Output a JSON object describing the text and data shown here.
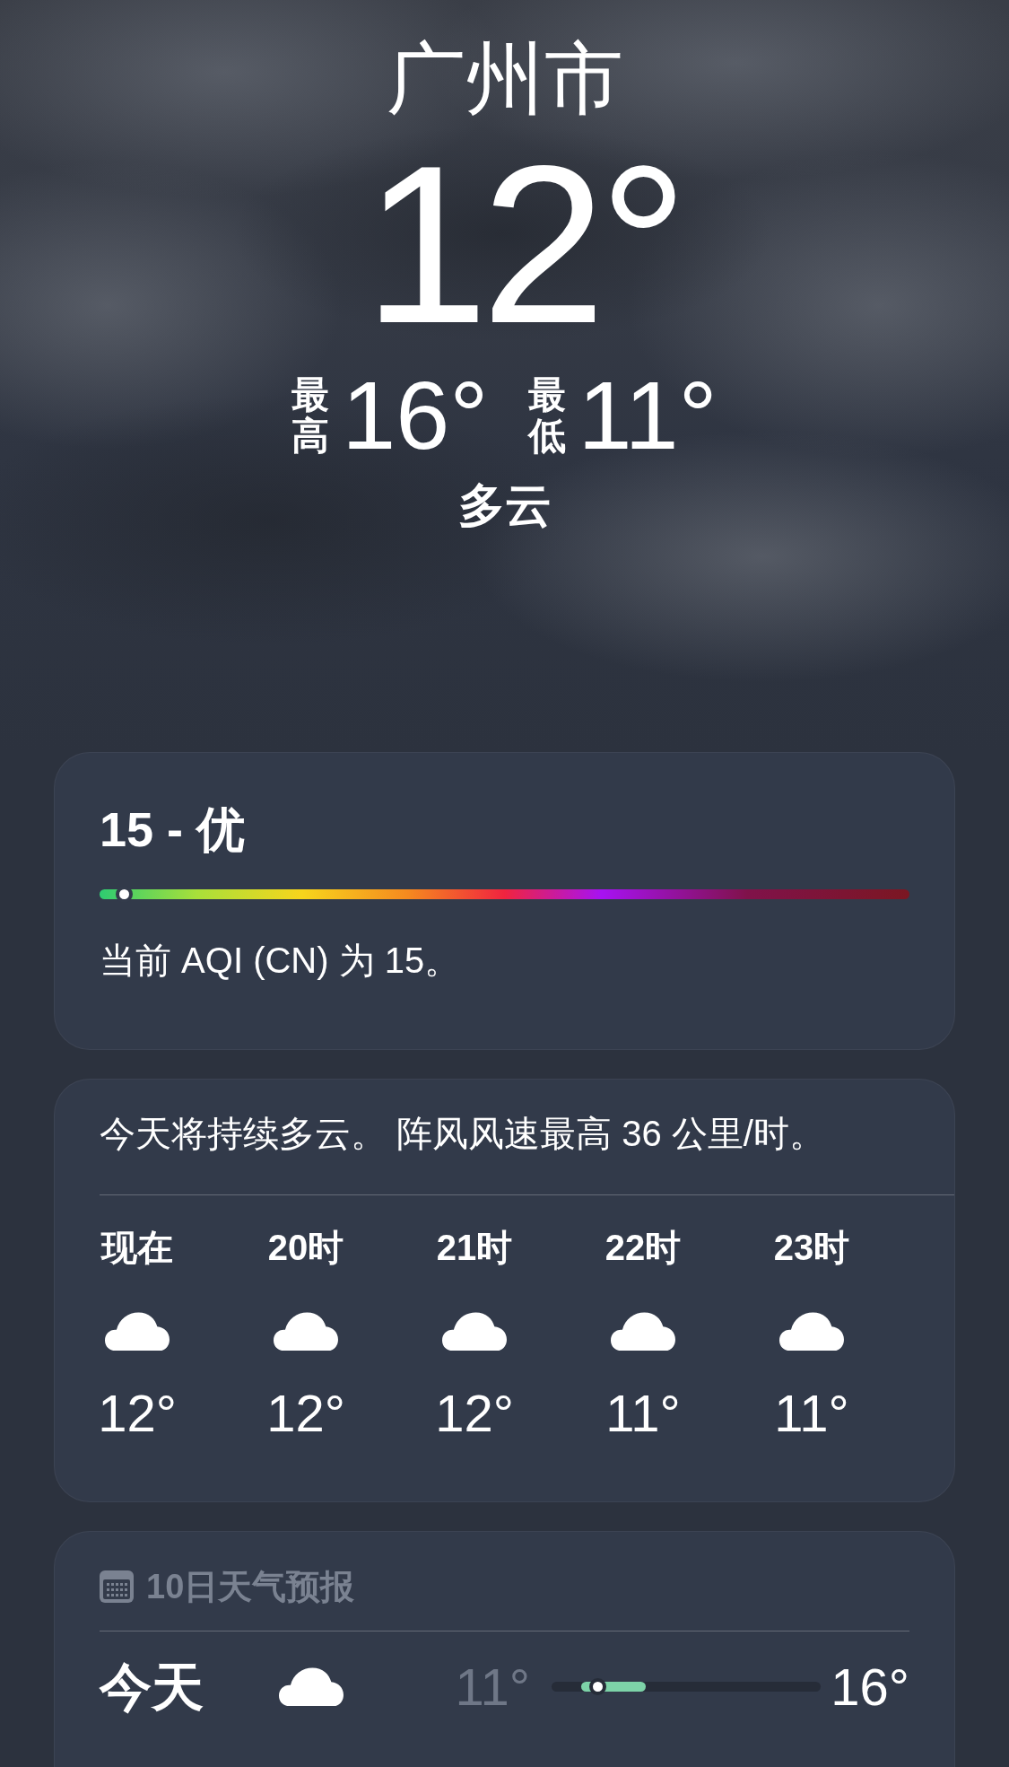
{
  "location": {
    "city": "广州市",
    "temperature": "12°",
    "high_label": "最高",
    "high": "16°",
    "low_label": "最低",
    "low": "11°",
    "condition": "多云"
  },
  "air_quality": {
    "headline": "15 - 优",
    "level": 0.03,
    "description": "当前 AQI (CN) 为 15。"
  },
  "hourly": {
    "summary": "今天将持续多云。 阵风风速最高 36 公里/时。",
    "hours": [
      {
        "label": "现在",
        "kind": "cloud",
        "temp": "12°"
      },
      {
        "label": "20时",
        "kind": "cloud",
        "temp": "12°"
      },
      {
        "label": "21时",
        "kind": "cloud",
        "temp": "12°"
      },
      {
        "label": "22时",
        "kind": "cloud",
        "temp": "11°"
      },
      {
        "label": "23时",
        "kind": "cloud",
        "temp": "11°"
      }
    ]
  },
  "forecast": {
    "title": "10日天气预报",
    "days": [
      {
        "day": "今天",
        "kind": "cloud",
        "low": "11°",
        "high": "16°",
        "level": 0.17
      }
    ]
  }
}
